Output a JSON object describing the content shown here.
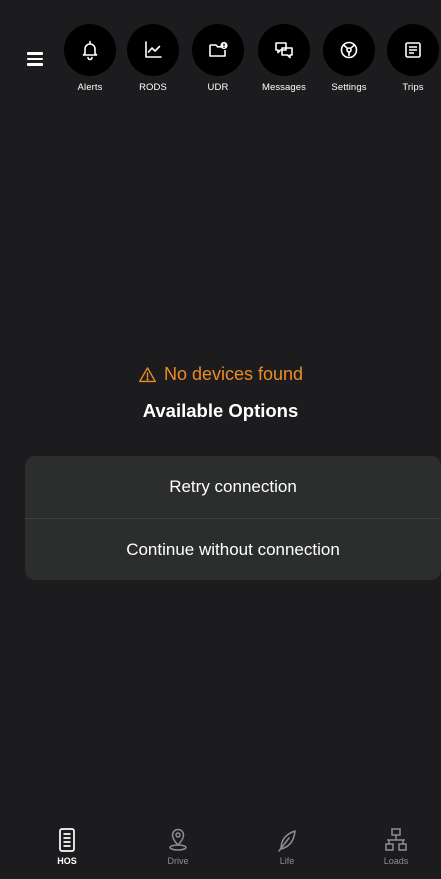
{
  "toolbar": {
    "items": [
      {
        "label": "Alerts",
        "icon": "bell-icon"
      },
      {
        "label": "RODS",
        "icon": "chart-icon"
      },
      {
        "label": "UDR",
        "icon": "folder-alert-icon"
      },
      {
        "label": "Messages",
        "icon": "chat-icon"
      },
      {
        "label": "Settings",
        "icon": "settings-icon"
      },
      {
        "label": "Trips",
        "icon": "trips-icon"
      }
    ]
  },
  "status": {
    "warning": "No devices found",
    "title": "Available Options"
  },
  "options": [
    {
      "label": "Retry connection"
    },
    {
      "label": "Continue without connection"
    }
  ],
  "tabs": [
    {
      "label": "HOS",
      "icon": "logbook-icon",
      "active": true
    },
    {
      "label": "Drive",
      "icon": "map-pin-icon",
      "active": false
    },
    {
      "label": "Life",
      "icon": "leaf-icon",
      "active": false
    },
    {
      "label": "Loads",
      "icon": "network-icon",
      "active": false
    }
  ],
  "colors": {
    "background": "#1c1c1e",
    "warning": "#f08a24",
    "card": "#2c2e2e",
    "inactive_tab": "#8e8e93"
  }
}
